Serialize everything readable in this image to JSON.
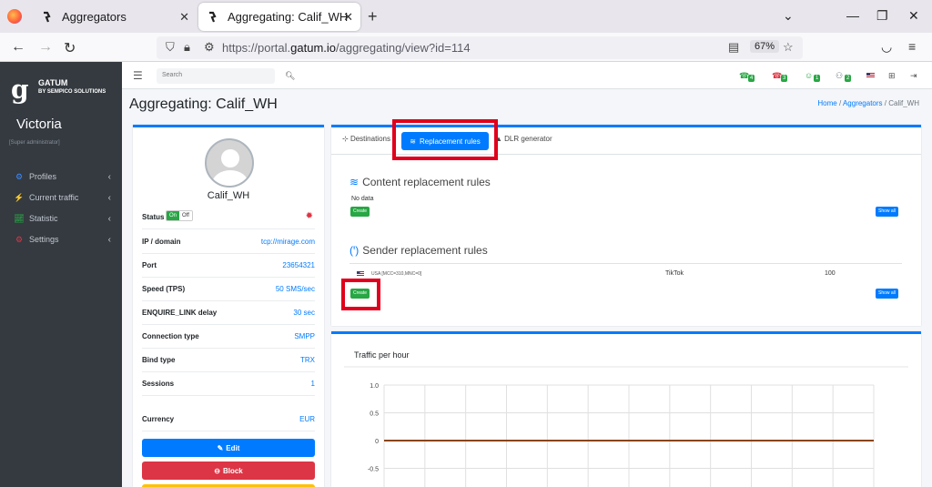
{
  "browser": {
    "tabs": [
      {
        "title": "Aggregators"
      },
      {
        "title": "Aggregating: Calif_WH"
      }
    ],
    "url_prefix": "https://portal.",
    "url_domain": "gatum.io",
    "url_path": "/aggregating/view?id=114",
    "zoom": "67%"
  },
  "sidebar": {
    "brand": "GATUM",
    "brand_sub": "BY SEMPICO SOLUTIONS",
    "user_name": "Victoria",
    "user_role": "[Super administrator]",
    "items": [
      {
        "label": "Profiles",
        "icon": "profiles-icon"
      },
      {
        "label": "Current traffic",
        "icon": "traffic-icon"
      },
      {
        "label": "Statistic",
        "icon": "chart-icon"
      },
      {
        "label": "Settings",
        "icon": "settings-icon"
      }
    ]
  },
  "topnav": {
    "search_placeholder": "Search",
    "badges": [
      "4",
      "3",
      "1",
      "2"
    ]
  },
  "page": {
    "title": "Aggregating: Calif_WH",
    "breadcrumb": [
      "Home",
      "Aggregators",
      "Calif_WH"
    ]
  },
  "profile": {
    "name": "Calif_WH",
    "status_label": "Status",
    "toggle_on": "On",
    "toggle_off": "Off",
    "rows": [
      {
        "label": "IP / domain",
        "value": "tcp://mirage.com"
      },
      {
        "label": "Port",
        "value": "23654321"
      },
      {
        "label": "Speed (TPS)",
        "value": "50 SMS/sec"
      },
      {
        "label": "ENQUIRE_LINK delay",
        "value": "30 sec"
      },
      {
        "label": "Connection type",
        "value": "SMPP"
      },
      {
        "label": "Bind type",
        "value": "TRX"
      },
      {
        "label": "Sessions",
        "value": "1"
      },
      {
        "label": "Currency",
        "value": "EUR"
      }
    ],
    "edit_label": "Edit",
    "block_label": "Block"
  },
  "rules": {
    "tabs": [
      "Destinations",
      "Replacement rules",
      "DLR generator"
    ],
    "content_title": "Content replacement rules",
    "no_data": "No data",
    "create_label": "Create",
    "show_all_label": "Show all",
    "sender_title": "Sender replacement rules",
    "sender_rows": [
      {
        "country": "USA [MCC=310,MNC=0]",
        "sender": "TikTok",
        "percent": "100"
      }
    ]
  },
  "colors": {
    "primary": "#007bff",
    "success": "#28a745",
    "danger": "#dc3545",
    "warning": "#ffc107",
    "highlight": "#e0001b",
    "chart_line": "#8b4513"
  },
  "chart_data": {
    "type": "line",
    "title": "Traffic per hour",
    "y_ticks": [
      "1.0",
      "0.5",
      "0",
      "-0.5"
    ],
    "ylim": [
      -0.5,
      1.0
    ],
    "series": [
      {
        "values": [
          0,
          0,
          0,
          0,
          0,
          0,
          0,
          0,
          0,
          0,
          0,
          0,
          0,
          0,
          0,
          0,
          0,
          0,
          0,
          0,
          0,
          0,
          0,
          0
        ]
      }
    ],
    "grid": true
  }
}
